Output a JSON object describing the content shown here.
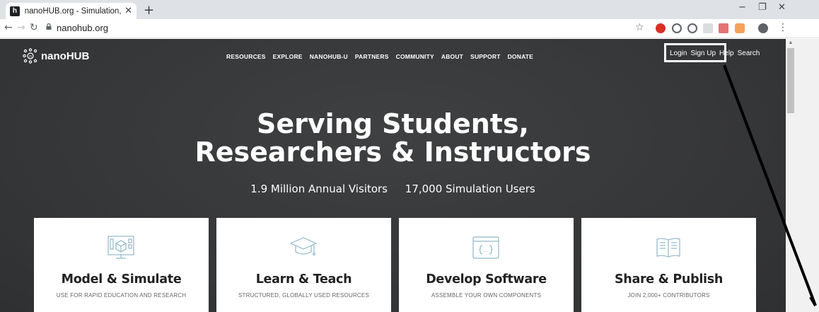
{
  "browser": {
    "tab_title": "nanoHUB.org - Simulation, Educ",
    "tab_favicon": "h",
    "url": "nanohub.org"
  },
  "site": {
    "logo_text": "nanoHUB",
    "nav": [
      "RESOURCES",
      "EXPLORE",
      "NANOHUB-U",
      "PARTNERS",
      "COMMUNITY",
      "ABOUT",
      "SUPPORT",
      "DONATE"
    ],
    "user_nav": {
      "login": "Login",
      "signup": "Sign Up",
      "help": "Help",
      "search": "Search"
    }
  },
  "hero": {
    "title_line1": "Serving Students,",
    "title_line2": "Researchers & Instructors",
    "stat1": "1.9 Million Annual Visitors",
    "stat2": "17,000 Simulation Users"
  },
  "cards": [
    {
      "title": "Model & Simulate",
      "sub": "USE FOR RAPID EDUCATION AND RESEARCH",
      "icon": "monitor-3d-icon"
    },
    {
      "title": "Learn & Teach",
      "sub": "STRUCTURED, GLOBALLY USED RESOURCES",
      "icon": "graduation-cap-icon"
    },
    {
      "title": "Develop Software",
      "sub": "ASSEMBLE YOUR OWN COMPONENTS",
      "icon": "code-window-icon"
    },
    {
      "title": "Share & Publish",
      "sub": "JOIN 2,000+ CONTRIBUTORS",
      "icon": "open-book-icon"
    }
  ],
  "colors": {
    "icon_accent": "#8fb8c9",
    "page_bg": "#3a3b3d"
  }
}
